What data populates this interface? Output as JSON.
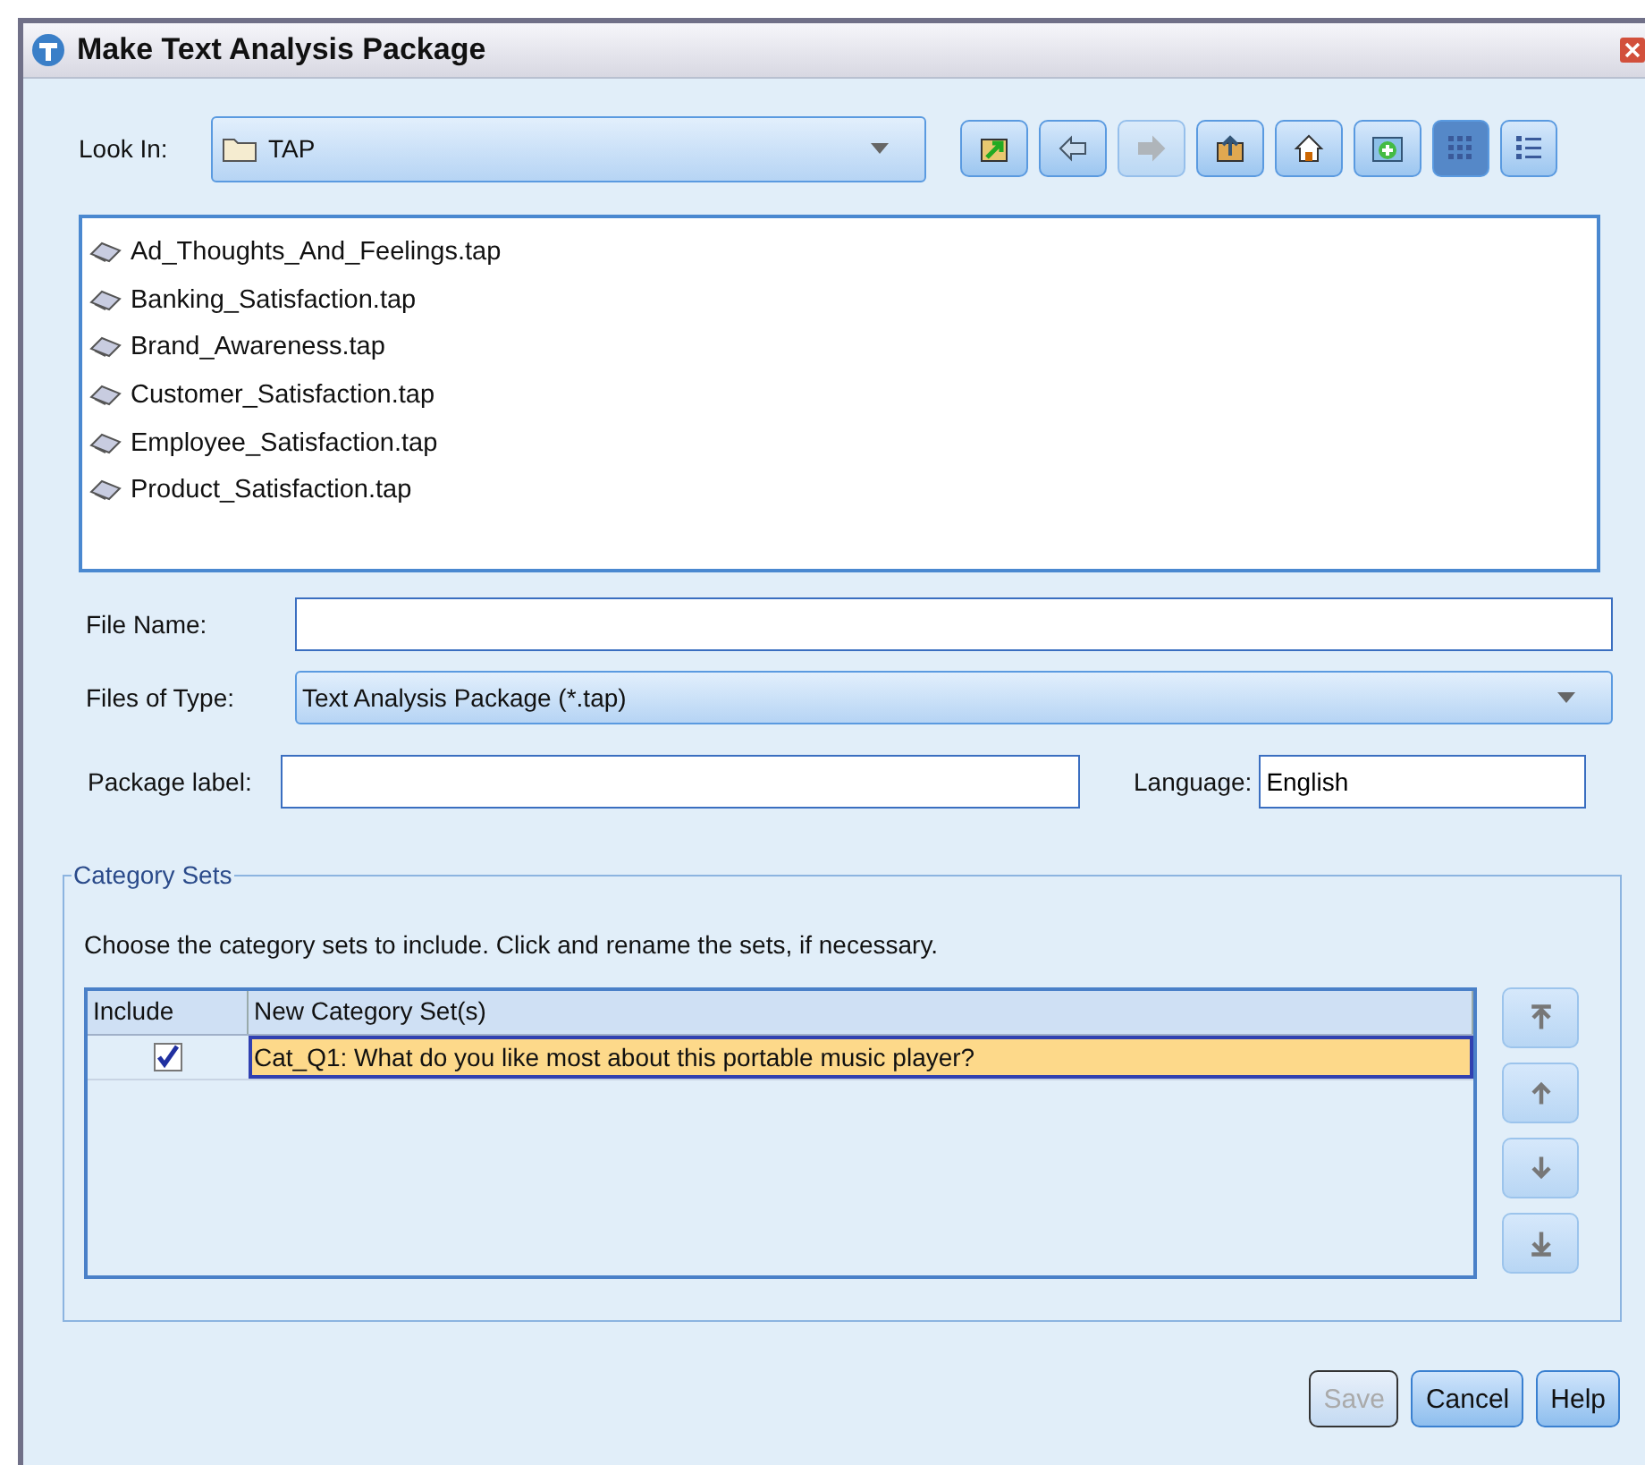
{
  "window": {
    "title": "Make Text Analysis Package"
  },
  "look_in": {
    "label": "Look In:",
    "value": "TAP"
  },
  "toolbar": [
    {
      "kind": "up-folder",
      "disabled": false,
      "selected": false
    },
    {
      "kind": "back",
      "disabled": false,
      "selected": false
    },
    {
      "kind": "forward",
      "disabled": true,
      "selected": false
    },
    {
      "kind": "upload",
      "disabled": false,
      "selected": false
    },
    {
      "kind": "home",
      "disabled": false,
      "selected": false
    },
    {
      "kind": "new-folder",
      "disabled": false,
      "selected": false
    },
    {
      "kind": "list-view",
      "disabled": false,
      "selected": true
    },
    {
      "kind": "details-view",
      "disabled": false,
      "selected": false
    }
  ],
  "files": [
    "Ad_Thoughts_And_Feelings.tap",
    "Banking_Satisfaction.tap",
    "Brand_Awareness.tap",
    "Customer_Satisfaction.tap",
    "Employee_Satisfaction.tap",
    "Product_Satisfaction.tap"
  ],
  "file_name": {
    "label": "File Name:"
  },
  "files_of_type": {
    "label": "Files of Type:",
    "value": "Text Analysis Package (*.tap)"
  },
  "package_label": {
    "label": "Package label:"
  },
  "language": {
    "label": "Language:",
    "value": "English"
  },
  "category_sets": {
    "title": "Category Sets",
    "instructions": "Choose the category sets to include. Click and rename the sets, if necessary.",
    "columns": [
      "Include",
      "New Category Set(s)"
    ],
    "rows": [
      {
        "include": true,
        "name": "Cat_Q1: What do you like most about this portable music player?",
        "selected": true
      }
    ],
    "move_buttons": [
      {
        "kind": "top"
      },
      {
        "kind": "up"
      },
      {
        "kind": "down"
      },
      {
        "kind": "bottom"
      }
    ]
  },
  "buttons": [
    {
      "label": "Save",
      "disabled": true
    },
    {
      "label": "Cancel",
      "disabled": false
    },
    {
      "label": "Help",
      "disabled": false
    }
  ]
}
